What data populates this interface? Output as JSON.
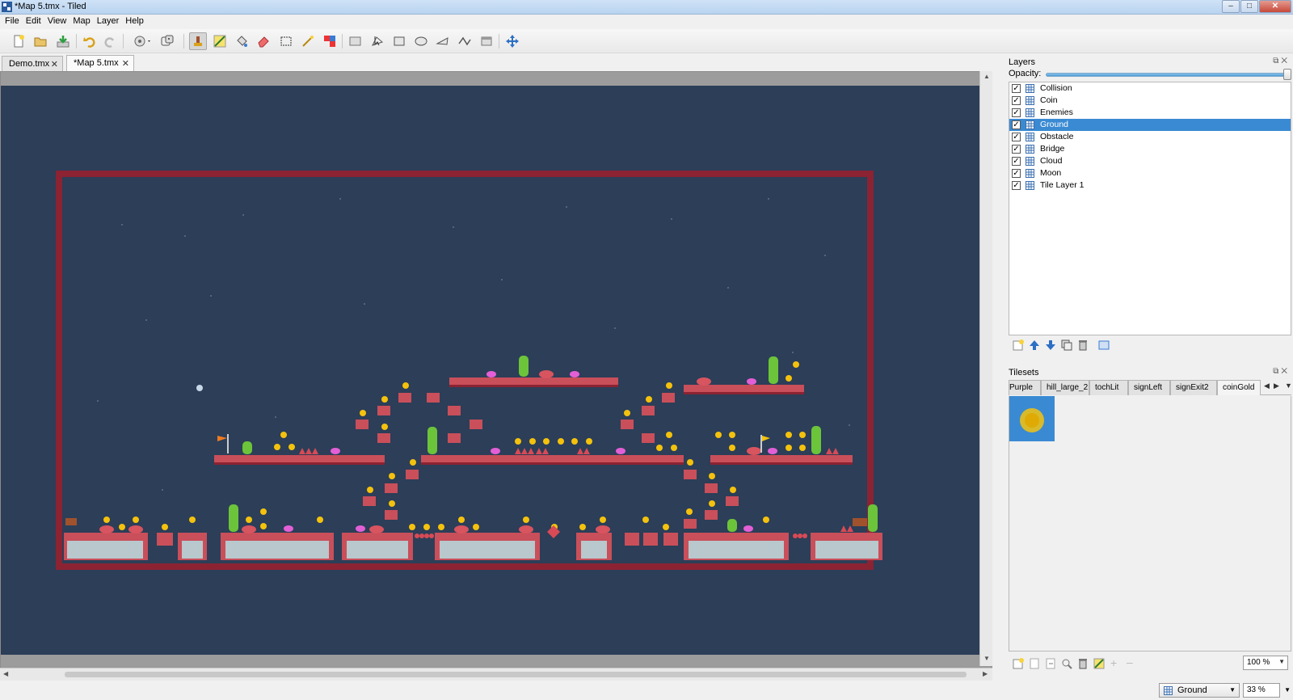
{
  "window": {
    "title": "*Map 5.tmx - Tiled"
  },
  "menu": {
    "items": [
      "File",
      "Edit",
      "View",
      "Map",
      "Layer",
      "Help"
    ]
  },
  "tabs": [
    {
      "label": "Demo.tmx"
    },
    {
      "label": "*Map 5.tmx"
    }
  ],
  "layers_panel": {
    "title": "Layers",
    "opacity_label": "Opacity:",
    "opacity": 1.0,
    "layers": [
      {
        "name": "Collision",
        "visible": true,
        "selected": false
      },
      {
        "name": "Coin",
        "visible": true,
        "selected": false
      },
      {
        "name": "Enemies",
        "visible": true,
        "selected": false
      },
      {
        "name": "Ground",
        "visible": true,
        "selected": true
      },
      {
        "name": "Obstacle",
        "visible": true,
        "selected": false
      },
      {
        "name": "Bridge",
        "visible": true,
        "selected": false
      },
      {
        "name": "Cloud",
        "visible": true,
        "selected": false
      },
      {
        "name": "Moon",
        "visible": true,
        "selected": false
      },
      {
        "name": "Tile Layer 1",
        "visible": true,
        "selected": false
      }
    ]
  },
  "tilesets_panel": {
    "title": "Tilesets",
    "tabs": [
      "Purple",
      "hill_large_2",
      "tochLit",
      "signLeft",
      "signExit2",
      "coinGold"
    ],
    "active_tab": "coinGold",
    "zoom": "100 %"
  },
  "status": {
    "current_layer": "Ground",
    "zoom": "33 %"
  },
  "colors": {
    "canvas_bg": "#2c3e58",
    "border_red": "#8b2333",
    "platform": "#c94f5a",
    "coin": "#f4c20d",
    "cactus": "#6cc43a",
    "selection": "#3a8ad3"
  }
}
